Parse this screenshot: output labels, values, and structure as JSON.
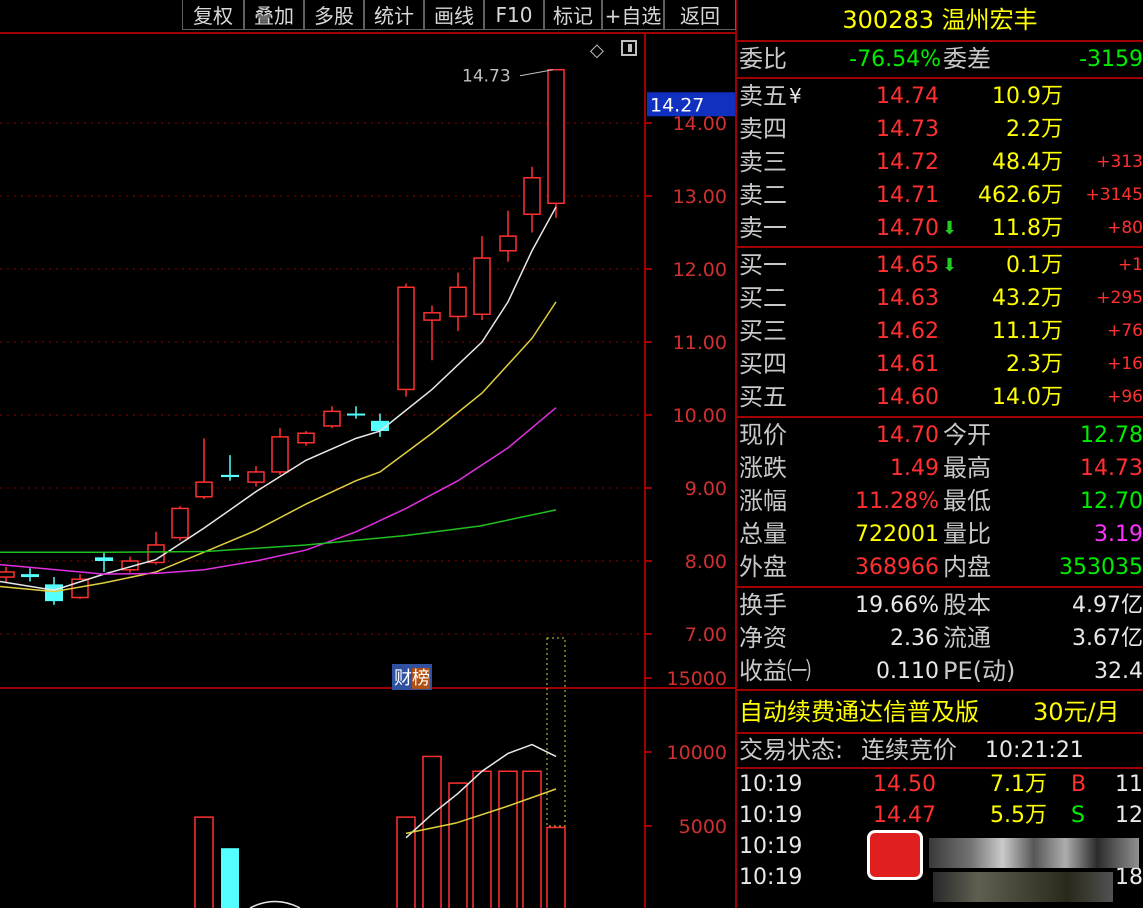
{
  "toolbar": {
    "buttons": [
      "复权",
      "叠加",
      "多股",
      "统计",
      "画线",
      "F10",
      "标记",
      "+自选",
      "返回"
    ]
  },
  "stock": {
    "code": "300283",
    "name": "温州宏丰"
  },
  "price_chart": {
    "high_label": "14.73",
    "current_price_tag": "14.27",
    "y_ticks": [
      "14.00",
      "13.00",
      "12.00",
      "11.00",
      "10.00",
      "9.00",
      "8.00",
      "7.00"
    ],
    "badge_left": "财",
    "badge_right": "榜"
  },
  "volume_chart": {
    "y_ticks": [
      "15000",
      "10000",
      "5000"
    ]
  },
  "committee": {
    "ratio_label": "委比",
    "ratio_value": "-76.54%",
    "diff_label": "委差",
    "diff_value": "-3159"
  },
  "asks": [
    {
      "label": "卖五",
      "extra": "¥",
      "price": "14.74",
      "volume": "10.9万",
      "change": ""
    },
    {
      "label": "卖四",
      "extra": "",
      "price": "14.73",
      "volume": "2.2万",
      "change": ""
    },
    {
      "label": "卖三",
      "extra": "",
      "price": "14.72",
      "volume": "48.4万",
      "change": "+313"
    },
    {
      "label": "卖二",
      "extra": "",
      "price": "14.71",
      "volume": "462.6万",
      "change": "+3145"
    },
    {
      "label": "卖一",
      "extra": "",
      "price": "14.70",
      "volume": "11.8万",
      "change": "+80"
    }
  ],
  "bids": [
    {
      "label": "买一",
      "price": "14.65",
      "volume": "0.1万",
      "change": "+1"
    },
    {
      "label": "买二",
      "price": "14.63",
      "volume": "43.2万",
      "change": "+295"
    },
    {
      "label": "买三",
      "price": "14.62",
      "volume": "11.1万",
      "change": "+76"
    },
    {
      "label": "买四",
      "price": "14.61",
      "volume": "2.3万",
      "change": "+16"
    },
    {
      "label": "买五",
      "price": "14.60",
      "volume": "14.0万",
      "change": "+96"
    }
  ],
  "quote": {
    "current_label": "现价",
    "current": "14.70",
    "open_label": "今开",
    "open": "12.78",
    "change_label": "涨跌",
    "change": "1.49",
    "high_label": "最高",
    "high": "14.73",
    "pct_label": "涨幅",
    "pct": "11.28%",
    "low_label": "最低",
    "low": "12.70",
    "vol_label": "总量",
    "vol": "722001",
    "volratio_label": "量比",
    "volratio": "3.19",
    "outer_label": "外盘",
    "outer": "368966",
    "inner_label": "内盘",
    "inner": "353035"
  },
  "fundamentals": {
    "turnover_label": "换手",
    "turnover": "19.66%",
    "equity_label": "股本",
    "equity": "4.97亿",
    "nav_label": "净资",
    "nav": "2.36",
    "float_label": "流通",
    "float": "3.67亿",
    "eps_label": "收益㈠",
    "eps": "0.110",
    "pe_label": "PE(动)",
    "pe": "32.4"
  },
  "promo": {
    "text": "自动续费通达信普及版",
    "price": "30元/月"
  },
  "trading": {
    "status_label": "交易状态:",
    "status": "连续竞价",
    "time": "10:21:21"
  },
  "ticks": [
    {
      "time": "10:19",
      "price": "14.50",
      "volume": "7.1万",
      "side": "B",
      "count": "11"
    },
    {
      "time": "10:19",
      "price": "14.47",
      "volume": "5.5万",
      "side": "S",
      "count": "12"
    },
    {
      "time": "10:19",
      "price": "",
      "volume": "",
      "side": "",
      "count": ""
    },
    {
      "time": "10:19",
      "price": "",
      "volume": "",
      "side": "",
      "count": "18"
    }
  ]
}
